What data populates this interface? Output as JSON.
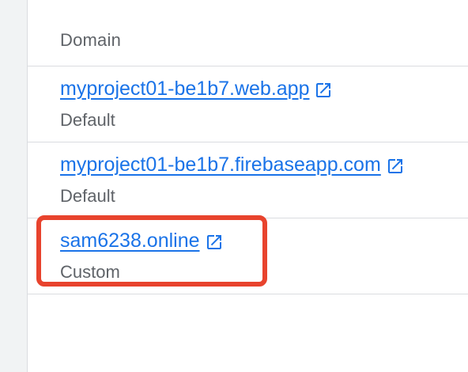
{
  "table": {
    "column_header": "Domain",
    "rows": [
      {
        "domain": "myproject01-be1b7.web.app",
        "type": "Default"
      },
      {
        "domain": "myproject01-be1b7.firebaseapp.com",
        "type": "Default"
      },
      {
        "domain": "sam6238.online",
        "type": "Custom"
      }
    ]
  },
  "icons": {
    "external_link": "open-in-new-icon"
  },
  "colors": {
    "link": "#1a73e8",
    "secondary_text": "#5f6368",
    "divider": "#dadce0",
    "highlight": "#e8432d"
  }
}
